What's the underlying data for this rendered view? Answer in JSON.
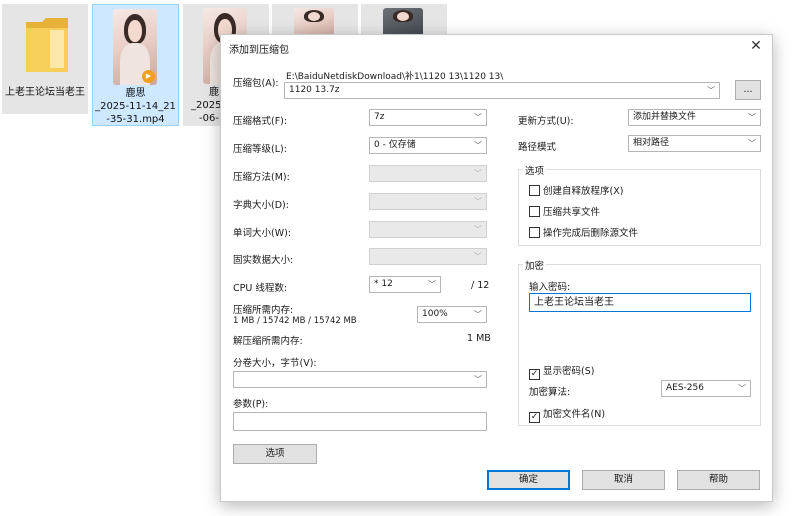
{
  "desktop": {
    "folder": {
      "name": "上老王论坛当老王"
    },
    "video1": {
      "line1": "鹿思",
      "line2": "_2025-11-14_21",
      "line3": "-35-31.mp4",
      "play": "▶"
    },
    "video2": {
      "line1": "鹿",
      "line2": "_2025-",
      "line3": "-06-1"
    }
  },
  "dialog": {
    "title": "添加到压缩包",
    "close": "✕",
    "archive": {
      "label": "压缩包(A):",
      "path": "E:\\BaiduNetdiskDownload\\补1\\1120 13\\1120 13\\",
      "value": "1120 13.7z",
      "browse": "..."
    },
    "left": {
      "format": {
        "label": "压缩格式(F):",
        "value": "7z"
      },
      "level": {
        "label": "压缩等级(L):",
        "value": "0 - 仅存储"
      },
      "method": {
        "label": "压缩方法(M):"
      },
      "dict": {
        "label": "字典大小(D):"
      },
      "word": {
        "label": "单词大小(W):"
      },
      "solid": {
        "label": "固实数据大小:"
      },
      "threads": {
        "label": "CPU 线程数:",
        "value": "* 12",
        "max": "/ 12"
      },
      "mem": {
        "label": "压缩所需内存:",
        "detail": "1 MB / 15742 MB / 15742 MB",
        "value": "100%"
      },
      "unmem": {
        "label": "解压缩所需内存:",
        "value": "1 MB"
      },
      "split": {
        "label": "分卷大小，字节(V):",
        "value": ""
      },
      "params": {
        "label": "参数(P):",
        "value": ""
      },
      "options_btn": "选项"
    },
    "right": {
      "update": {
        "label": "更新方式(U):",
        "value": "添加并替换文件"
      },
      "pathmode": {
        "label": "路径模式",
        "value": "相对路径"
      },
      "options": {
        "title": "选项",
        "sfx": "创建自释放程序(X)",
        "shared": "压缩共享文件",
        "delete": "操作完成后删除源文件"
      },
      "encryption": {
        "title": "加密",
        "pwd_label": "输入密码:",
        "pwd_value": "上老王论坛当老王",
        "show_pwd": "显示密码(S)",
        "show_pwd_checked": "✓",
        "method_label": "加密算法:",
        "method_value": "AES-256",
        "encrypt_names": "加密文件名(N)",
        "encrypt_names_checked": "✓"
      }
    },
    "buttons": {
      "ok": "确定",
      "cancel": "取消",
      "help": "帮助"
    }
  }
}
